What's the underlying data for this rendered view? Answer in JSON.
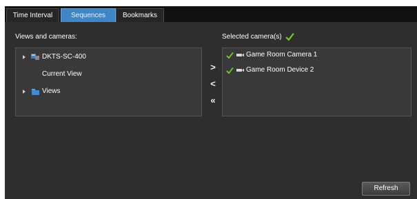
{
  "tabs": [
    {
      "label": "Time Interval",
      "active": false
    },
    {
      "label": "Sequences",
      "active": true
    },
    {
      "label": "Bookmarks",
      "active": false
    }
  ],
  "views_panel": {
    "label": "Views and cameras:",
    "tree": [
      {
        "label": "DKTS-SC-400",
        "icon": "server-icon",
        "expandable": true
      },
      {
        "label": "Current View",
        "icon": "",
        "expandable": false
      },
      {
        "label": "Views",
        "icon": "folder-icon",
        "expandable": true
      }
    ]
  },
  "transfer_buttons": {
    "add": ">",
    "remove": "<",
    "remove_all": "«"
  },
  "selected_panel": {
    "label": "Selected camera(s)",
    "items": [
      {
        "label": "Game Room Camera 1",
        "icon": "camera-icon",
        "checked": true
      },
      {
        "label": "Game Room Device 2",
        "icon": "camera-icon",
        "checked": true
      }
    ]
  },
  "refresh_label": "Refresh",
  "colors": {
    "background": "#2e2e2e",
    "tab_active": "#3f86c8",
    "check": "#6bd321"
  }
}
